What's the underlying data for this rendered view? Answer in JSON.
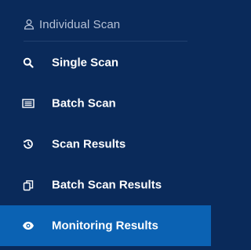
{
  "sidebar": {
    "section_title": "Individual Scan",
    "items": [
      {
        "label": "Single Scan",
        "icon": "search-icon"
      },
      {
        "label": "Batch Scan",
        "icon": "list-icon"
      },
      {
        "label": "Scan Results",
        "icon": "history-icon"
      },
      {
        "label": "Batch Scan Results",
        "icon": "copy-icon"
      },
      {
        "label": "Monitoring Results",
        "icon": "eye-icon",
        "active": true
      }
    ]
  },
  "colors": {
    "background": "#0a2a5a",
    "active_background": "#0b62b3",
    "section_text": "#b5c1d6",
    "item_text": "#ffffff"
  }
}
